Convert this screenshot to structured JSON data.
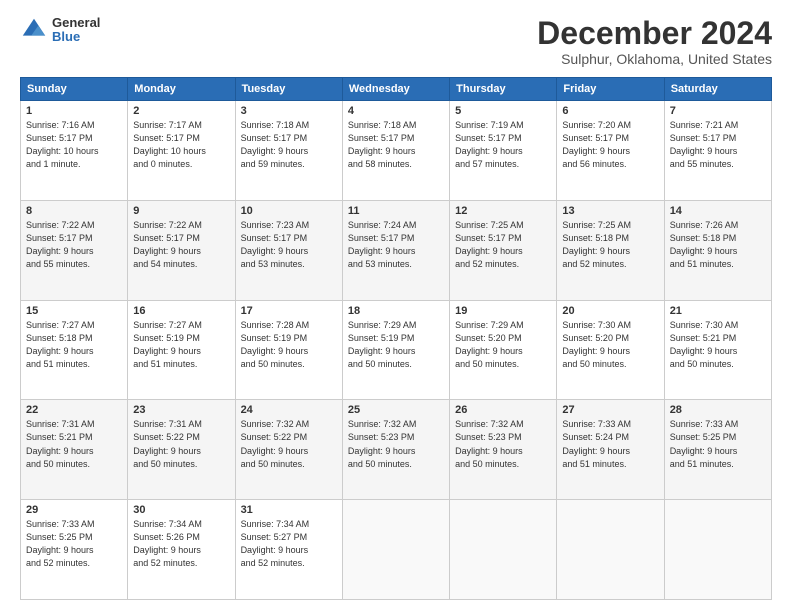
{
  "logo": {
    "general": "General",
    "blue": "Blue"
  },
  "header": {
    "title": "December 2024",
    "subtitle": "Sulphur, Oklahoma, United States"
  },
  "weekdays": [
    "Sunday",
    "Monday",
    "Tuesday",
    "Wednesday",
    "Thursday",
    "Friday",
    "Saturday"
  ],
  "weeks": [
    [
      {
        "day": "1",
        "info": "Sunrise: 7:16 AM\nSunset: 5:17 PM\nDaylight: 10 hours\nand 1 minute."
      },
      {
        "day": "2",
        "info": "Sunrise: 7:17 AM\nSunset: 5:17 PM\nDaylight: 10 hours\nand 0 minutes."
      },
      {
        "day": "3",
        "info": "Sunrise: 7:18 AM\nSunset: 5:17 PM\nDaylight: 9 hours\nand 59 minutes."
      },
      {
        "day": "4",
        "info": "Sunrise: 7:18 AM\nSunset: 5:17 PM\nDaylight: 9 hours\nand 58 minutes."
      },
      {
        "day": "5",
        "info": "Sunrise: 7:19 AM\nSunset: 5:17 PM\nDaylight: 9 hours\nand 57 minutes."
      },
      {
        "day": "6",
        "info": "Sunrise: 7:20 AM\nSunset: 5:17 PM\nDaylight: 9 hours\nand 56 minutes."
      },
      {
        "day": "7",
        "info": "Sunrise: 7:21 AM\nSunset: 5:17 PM\nDaylight: 9 hours\nand 55 minutes."
      }
    ],
    [
      {
        "day": "8",
        "info": "Sunrise: 7:22 AM\nSunset: 5:17 PM\nDaylight: 9 hours\nand 55 minutes."
      },
      {
        "day": "9",
        "info": "Sunrise: 7:22 AM\nSunset: 5:17 PM\nDaylight: 9 hours\nand 54 minutes."
      },
      {
        "day": "10",
        "info": "Sunrise: 7:23 AM\nSunset: 5:17 PM\nDaylight: 9 hours\nand 53 minutes."
      },
      {
        "day": "11",
        "info": "Sunrise: 7:24 AM\nSunset: 5:17 PM\nDaylight: 9 hours\nand 53 minutes."
      },
      {
        "day": "12",
        "info": "Sunrise: 7:25 AM\nSunset: 5:17 PM\nDaylight: 9 hours\nand 52 minutes."
      },
      {
        "day": "13",
        "info": "Sunrise: 7:25 AM\nSunset: 5:18 PM\nDaylight: 9 hours\nand 52 minutes."
      },
      {
        "day": "14",
        "info": "Sunrise: 7:26 AM\nSunset: 5:18 PM\nDaylight: 9 hours\nand 51 minutes."
      }
    ],
    [
      {
        "day": "15",
        "info": "Sunrise: 7:27 AM\nSunset: 5:18 PM\nDaylight: 9 hours\nand 51 minutes."
      },
      {
        "day": "16",
        "info": "Sunrise: 7:27 AM\nSunset: 5:19 PM\nDaylight: 9 hours\nand 51 minutes."
      },
      {
        "day": "17",
        "info": "Sunrise: 7:28 AM\nSunset: 5:19 PM\nDaylight: 9 hours\nand 50 minutes."
      },
      {
        "day": "18",
        "info": "Sunrise: 7:29 AM\nSunset: 5:19 PM\nDaylight: 9 hours\nand 50 minutes."
      },
      {
        "day": "19",
        "info": "Sunrise: 7:29 AM\nSunset: 5:20 PM\nDaylight: 9 hours\nand 50 minutes."
      },
      {
        "day": "20",
        "info": "Sunrise: 7:30 AM\nSunset: 5:20 PM\nDaylight: 9 hours\nand 50 minutes."
      },
      {
        "day": "21",
        "info": "Sunrise: 7:30 AM\nSunset: 5:21 PM\nDaylight: 9 hours\nand 50 minutes."
      }
    ],
    [
      {
        "day": "22",
        "info": "Sunrise: 7:31 AM\nSunset: 5:21 PM\nDaylight: 9 hours\nand 50 minutes."
      },
      {
        "day": "23",
        "info": "Sunrise: 7:31 AM\nSunset: 5:22 PM\nDaylight: 9 hours\nand 50 minutes."
      },
      {
        "day": "24",
        "info": "Sunrise: 7:32 AM\nSunset: 5:22 PM\nDaylight: 9 hours\nand 50 minutes."
      },
      {
        "day": "25",
        "info": "Sunrise: 7:32 AM\nSunset: 5:23 PM\nDaylight: 9 hours\nand 50 minutes."
      },
      {
        "day": "26",
        "info": "Sunrise: 7:32 AM\nSunset: 5:23 PM\nDaylight: 9 hours\nand 50 minutes."
      },
      {
        "day": "27",
        "info": "Sunrise: 7:33 AM\nSunset: 5:24 PM\nDaylight: 9 hours\nand 51 minutes."
      },
      {
        "day": "28",
        "info": "Sunrise: 7:33 AM\nSunset: 5:25 PM\nDaylight: 9 hours\nand 51 minutes."
      }
    ],
    [
      {
        "day": "29",
        "info": "Sunrise: 7:33 AM\nSunset: 5:25 PM\nDaylight: 9 hours\nand 52 minutes."
      },
      {
        "day": "30",
        "info": "Sunrise: 7:34 AM\nSunset: 5:26 PM\nDaylight: 9 hours\nand 52 minutes."
      },
      {
        "day": "31",
        "info": "Sunrise: 7:34 AM\nSunset: 5:27 PM\nDaylight: 9 hours\nand 52 minutes."
      },
      {
        "day": "",
        "info": ""
      },
      {
        "day": "",
        "info": ""
      },
      {
        "day": "",
        "info": ""
      },
      {
        "day": "",
        "info": ""
      }
    ]
  ]
}
